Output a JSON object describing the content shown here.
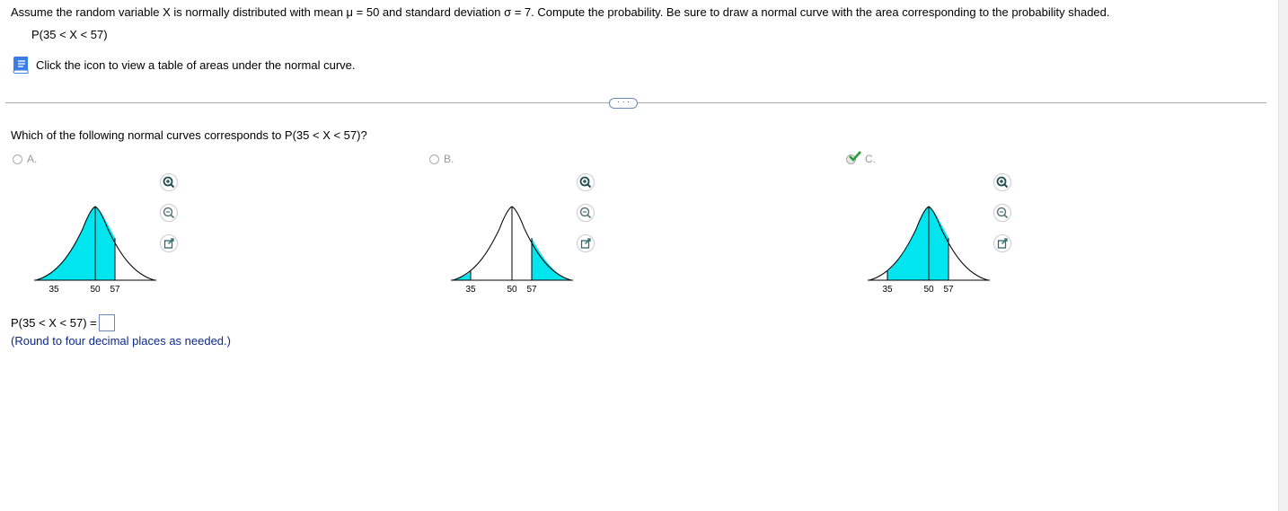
{
  "problem": {
    "text": "Assume the random variable X is normally distributed with mean μ = 50 and standard deviation σ = 7. Compute the probability. Be sure to draw a normal curve with the area corresponding to the probability shaded.",
    "expression": "P(35 < X < 57)",
    "table_link_label": "Click the icon to view a table of areas under the normal curve."
  },
  "more_button_label": "· · ·",
  "question": "Which of the following normal curves corresponds to P(35 < X < 57)?",
  "options": [
    {
      "label": "A.",
      "ticks": [
        "35",
        "50",
        "57"
      ],
      "shaded": "left-to-57",
      "selected": false,
      "correct": false
    },
    {
      "label": "B.",
      "ticks": [
        "35",
        "50",
        "57"
      ],
      "shaded": "tails",
      "selected": false,
      "correct": false
    },
    {
      "label": "C.",
      "ticks": [
        "35",
        "50",
        "57"
      ],
      "shaded": "35-to-57",
      "selected": true,
      "correct": true
    }
  ],
  "answer": {
    "prefix": "P(35 < X < 57) =",
    "value": "",
    "note": "(Round to four decimal places as needed.)"
  },
  "colors": {
    "shade": "#00E5EE",
    "check": "#2a9d3a",
    "link": "#0b2a8a",
    "book_icon": "#3d7ee6"
  },
  "icons": [
    "book-icon",
    "zoom-in-icon",
    "zoom-out-icon",
    "popout-icon",
    "checkmark-icon"
  ]
}
